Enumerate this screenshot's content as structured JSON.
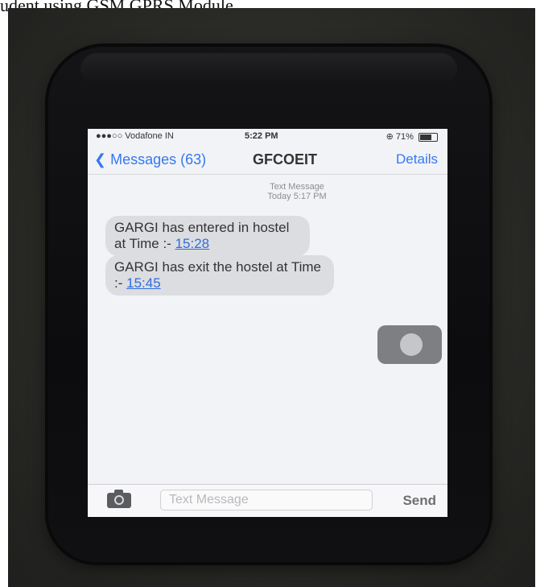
{
  "caption": "udent using GSM GPRS Module.",
  "status_bar": {
    "carrier": "●●●○○ Vodafone IN",
    "time": "5:22 PM",
    "battery": "⊕ 71%"
  },
  "nav": {
    "back_label": "Messages (63)",
    "title": "GFCOEIT",
    "details_label": "Details"
  },
  "thread_meta": {
    "type": "Text Message",
    "date": "Today 5:17 PM"
  },
  "messages": [
    {
      "text": "GARGI has entered in hostel at Time :- ",
      "time_link": "15:28"
    },
    {
      "text": "GARGI has exit the hostel at Time :- ",
      "time_link": "15:45"
    }
  ],
  "composer": {
    "placeholder": "Text Message",
    "send_label": "Send"
  },
  "icons": {
    "back": "chevron-left-icon",
    "camera": "camera-icon",
    "assistive_touch": "assistive-touch-icon"
  },
  "colors": {
    "ios_blue": "#3478f0",
    "bubble_gray": "#dcdde1",
    "link_blue": "#2f6de0"
  }
}
